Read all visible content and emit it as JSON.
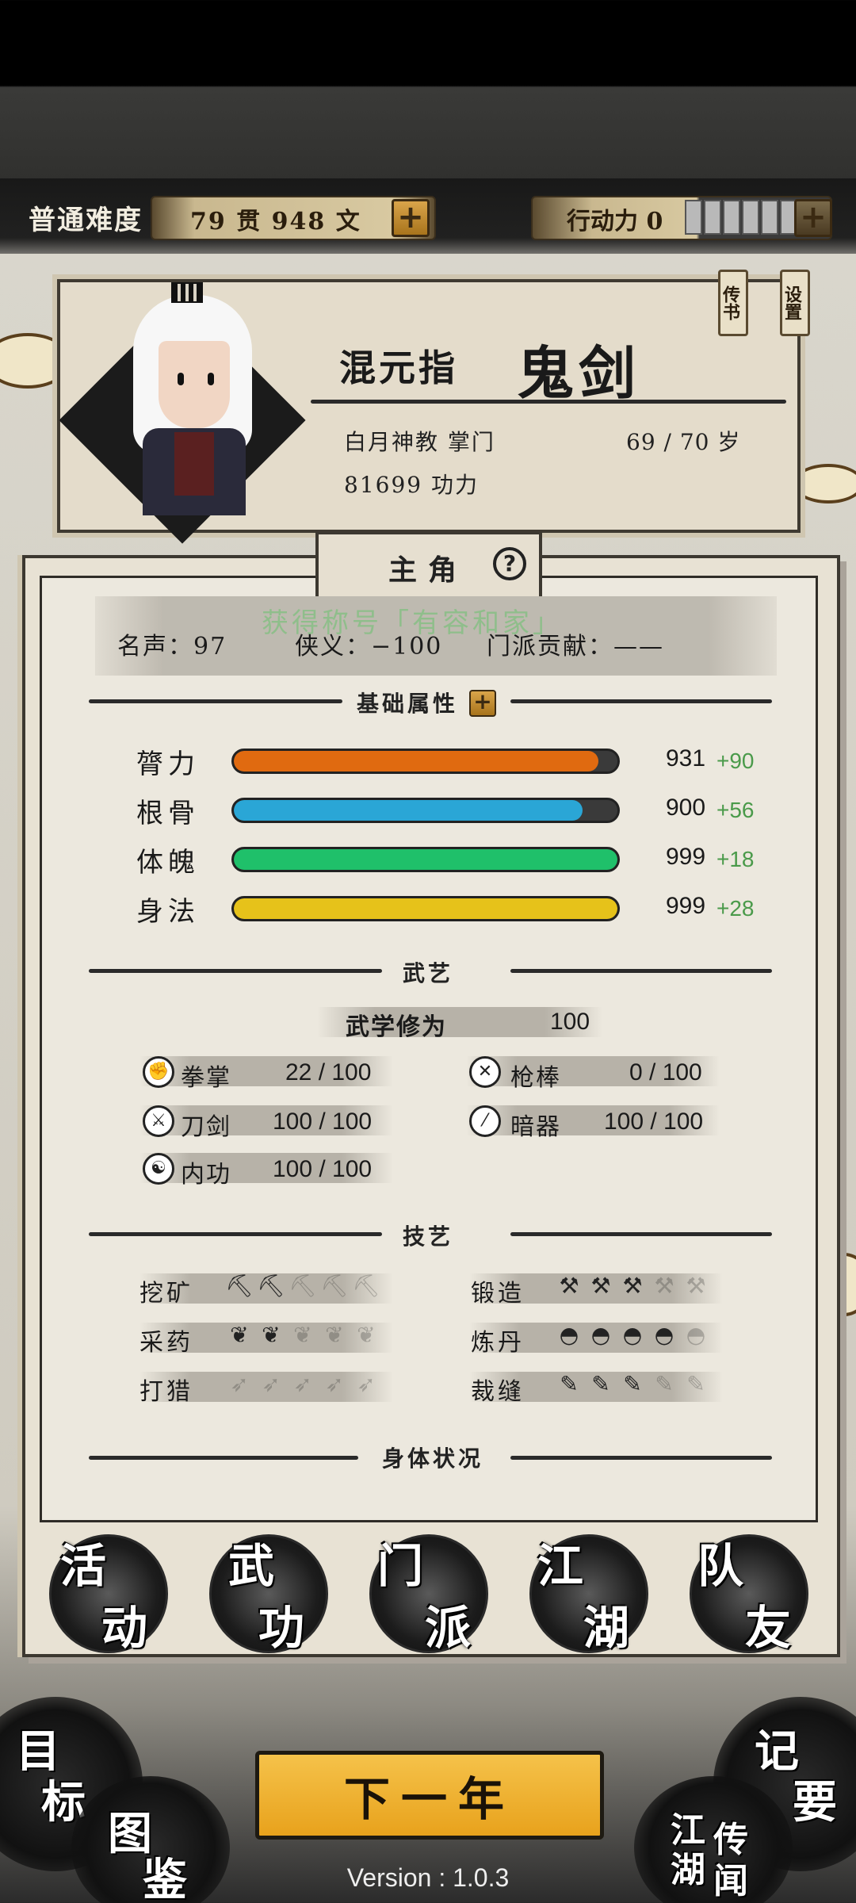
{
  "header": {
    "difficulty": "普通难度",
    "money": "79 贯 948 文",
    "action_points": "行动力 0"
  },
  "side_tags": {
    "letter": "传书",
    "settings": "设置"
  },
  "hero": {
    "name_prefix": "混元指",
    "name": "鬼剑",
    "sect_role": "白月神教 掌门",
    "age": "69 / 70 岁",
    "power": "81699 功力"
  },
  "panel": {
    "tab": "主角",
    "help_icon": "?",
    "faded_title": "获得称号「有容和家」",
    "stats": {
      "fame": "名声：97",
      "chivalry": "侠义：−100",
      "contribution": "门派贡献：——"
    }
  },
  "attributes": {
    "title": "基础属性",
    "items": [
      {
        "label": "膂力",
        "value": "931",
        "bonus": "+90",
        "fill": 0.95,
        "color": "#e06a10"
      },
      {
        "label": "根骨",
        "value": "900",
        "bonus": "+56",
        "fill": 0.91,
        "color": "#2aa6d6"
      },
      {
        "label": "体魄",
        "value": "999",
        "bonus": "+18",
        "fill": 1.0,
        "color": "#1fc06a"
      },
      {
        "label": "身法",
        "value": "999",
        "bonus": "+28",
        "fill": 1.0,
        "color": "#e6c21a"
      }
    ]
  },
  "martial": {
    "title": "武艺",
    "cultivation_label": "武学修为",
    "cultivation_value": "100",
    "skills": [
      {
        "label": "拳掌",
        "value": "22 / 100",
        "icon": "fist-icon"
      },
      {
        "label": "枪棒",
        "value": "0 / 100",
        "icon": "spear-icon"
      },
      {
        "label": "刀剑",
        "value": "100 / 100",
        "icon": "sword-icon"
      },
      {
        "label": "暗器",
        "value": "100 / 100",
        "icon": "dart-icon"
      },
      {
        "label": "内功",
        "value": "100 / 100",
        "icon": "inner-icon"
      }
    ]
  },
  "crafts": {
    "title": "技艺",
    "items": [
      {
        "label": "挖矿",
        "level": 2,
        "icon": "pickaxe-icon",
        "glyph": "⛏"
      },
      {
        "label": "锻造",
        "level": 3,
        "icon": "anvil-icon",
        "glyph": "⚒"
      },
      {
        "label": "采药",
        "level": 2,
        "icon": "herb-icon",
        "glyph": "❦"
      },
      {
        "label": "炼丹",
        "level": 4,
        "icon": "bowl-icon",
        "glyph": "◓"
      },
      {
        "label": "打猎",
        "level": 0,
        "icon": "bow-icon",
        "glyph": "➶"
      },
      {
        "label": "裁缝",
        "level": 3,
        "icon": "needle-icon",
        "glyph": "✎"
      }
    ]
  },
  "body_status_title": "身体状况",
  "nav": [
    {
      "top": "活",
      "bottom": "动"
    },
    {
      "top": "武",
      "bottom": "功"
    },
    {
      "top": "门",
      "bottom": "派"
    },
    {
      "top": "江",
      "bottom": "湖"
    },
    {
      "top": "队",
      "bottom": "友"
    }
  ],
  "bottom": {
    "goal_1": "目",
    "goal_2": "标",
    "atlas_1": "图",
    "atlas_2": "鉴",
    "notes_1": "记",
    "notes_2": "要",
    "legend_1": "江",
    "legend_2": "湖",
    "legend_3": "传",
    "legend_4": "闻",
    "next_year": "下一年",
    "version": "Version : 1.0.3"
  },
  "colors": {
    "accent_gold": "#e8a21c",
    "bonus_green": "#4a9a4a"
  }
}
